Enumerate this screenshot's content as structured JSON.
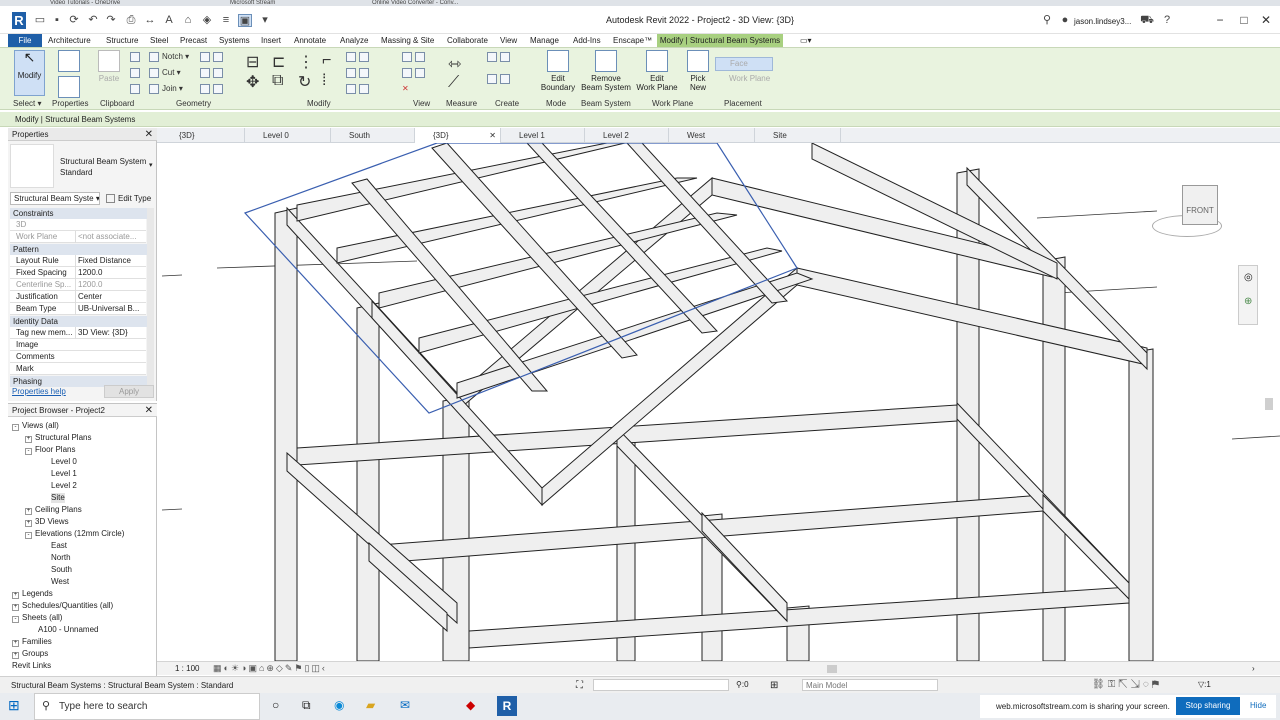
{
  "browser_tabs": [
    "Video Tutorials - OneDrive",
    "Microsoft Stream",
    "Online Video Converter - Conv..."
  ],
  "title": "Autodesk Revit 2022 - Project2 - 3D View: {3D}",
  "user": "jason.lindsey3...",
  "ribbon_tabs": [
    "File",
    "Architecture",
    "Structure",
    "Steel",
    "Precast",
    "Systems",
    "Insert",
    "Annotate",
    "Analyze",
    "Massing & Site",
    "Collaborate",
    "View",
    "Manage",
    "Add-Ins",
    "Enscape™",
    "Modify | Structural Beam Systems"
  ],
  "ribbon": {
    "modify": "Modify",
    "select": "Select",
    "properties": "Properties",
    "clipboard": "Clipboard",
    "paste": "Paste",
    "notch": "Notch",
    "cut": "Cut",
    "join": "Join",
    "geometry": "Geometry",
    "modify_panel": "Modify",
    "view": "View",
    "measure": "Measure",
    "create": "Create",
    "edit_boundary": [
      "Edit",
      "Boundary"
    ],
    "mode": "Mode",
    "remove_beam_system": [
      "Remove",
      "Beam System"
    ],
    "beam_system": "Beam System",
    "edit_work_plane": [
      "Edit",
      "Work Plane"
    ],
    "work_plane": "Work Plane",
    "pick_new": [
      "Pick",
      "New"
    ],
    "face": "Face",
    "work_plane_btn": "Work Plane",
    "placement": "Placement"
  },
  "context_label": "Modify | Structural Beam Systems",
  "properties": {
    "title": "Properties",
    "type_name": [
      "Structural Beam System",
      "Standard"
    ],
    "selector": "Structural Beam Syste",
    "edit_type": "Edit Type",
    "sections": {
      "constraints": "Constraints",
      "pattern": "Pattern",
      "identity": "Identity Data",
      "phasing": "Phasing"
    },
    "rows": [
      {
        "k": "3D",
        "v": ""
      },
      {
        "k": "Work Plane",
        "v": "<not associate..."
      },
      {
        "k": "Layout Rule",
        "v": "Fixed Distance"
      },
      {
        "k": "Fixed Spacing",
        "v": "1200.0"
      },
      {
        "k": "Centerline Sp...",
        "v": "1200.0"
      },
      {
        "k": "Justification",
        "v": "Center"
      },
      {
        "k": "Beam Type",
        "v": "UB-Universal B..."
      },
      {
        "k": "Tag new mem...",
        "v": "3D View: {3D}"
      },
      {
        "k": "Image",
        "v": ""
      },
      {
        "k": "Comments",
        "v": ""
      },
      {
        "k": "Mark",
        "v": ""
      }
    ],
    "help": "Properties help",
    "apply": "Apply"
  },
  "browser": {
    "title": "Project Browser - Project2",
    "nodes": [
      {
        "t": "Views (all)",
        "d": 0,
        "s": "-"
      },
      {
        "t": "Structural Plans",
        "d": 1,
        "s": "+"
      },
      {
        "t": "Floor Plans",
        "d": 1,
        "s": "-"
      },
      {
        "t": "Level 0",
        "d": 3,
        "s": ""
      },
      {
        "t": "Level 1",
        "d": 3,
        "s": ""
      },
      {
        "t": "Level 2",
        "d": 3,
        "s": ""
      },
      {
        "t": "Site",
        "d": 3,
        "s": ""
      },
      {
        "t": "Ceiling Plans",
        "d": 1,
        "s": "+"
      },
      {
        "t": "3D Views",
        "d": 1,
        "s": "+"
      },
      {
        "t": "Elevations (12mm Circle)",
        "d": 1,
        "s": "-"
      },
      {
        "t": "East",
        "d": 3,
        "s": ""
      },
      {
        "t": "North",
        "d": 3,
        "s": ""
      },
      {
        "t": "South",
        "d": 3,
        "s": ""
      },
      {
        "t": "West",
        "d": 3,
        "s": ""
      },
      {
        "t": "Legends",
        "d": 0,
        "s": "+"
      },
      {
        "t": "Schedules/Quantities (all)",
        "d": 0,
        "s": "+"
      },
      {
        "t": "Sheets (all)",
        "d": 0,
        "s": "-"
      },
      {
        "t": "A100 - Unnamed",
        "d": 2,
        "s": ""
      },
      {
        "t": "Families",
        "d": 0,
        "s": "+"
      },
      {
        "t": "Groups",
        "d": 0,
        "s": "+"
      },
      {
        "t": "Revit Links",
        "d": 0,
        "s": ""
      }
    ]
  },
  "view_tabs": [
    "{3D}",
    "Level 0",
    "South",
    "{3D}",
    "Level 1",
    "Level 2",
    "West",
    "Site"
  ],
  "viewcube": "FRONT",
  "scale": "1 : 100",
  "status": "Structural Beam Systems : Structural Beam System : Standard",
  "status_right": {
    "count": ":0",
    "model": "Main Model",
    "filter": ":1"
  },
  "taskbar": {
    "search": "Type here to search",
    "share": "web.microsoftstream.com is sharing your screen.",
    "stop": "Stop sharing",
    "hide": "Hide"
  },
  "colors": {
    "accent": "#1f5fa8",
    "context": "#a8d080"
  }
}
